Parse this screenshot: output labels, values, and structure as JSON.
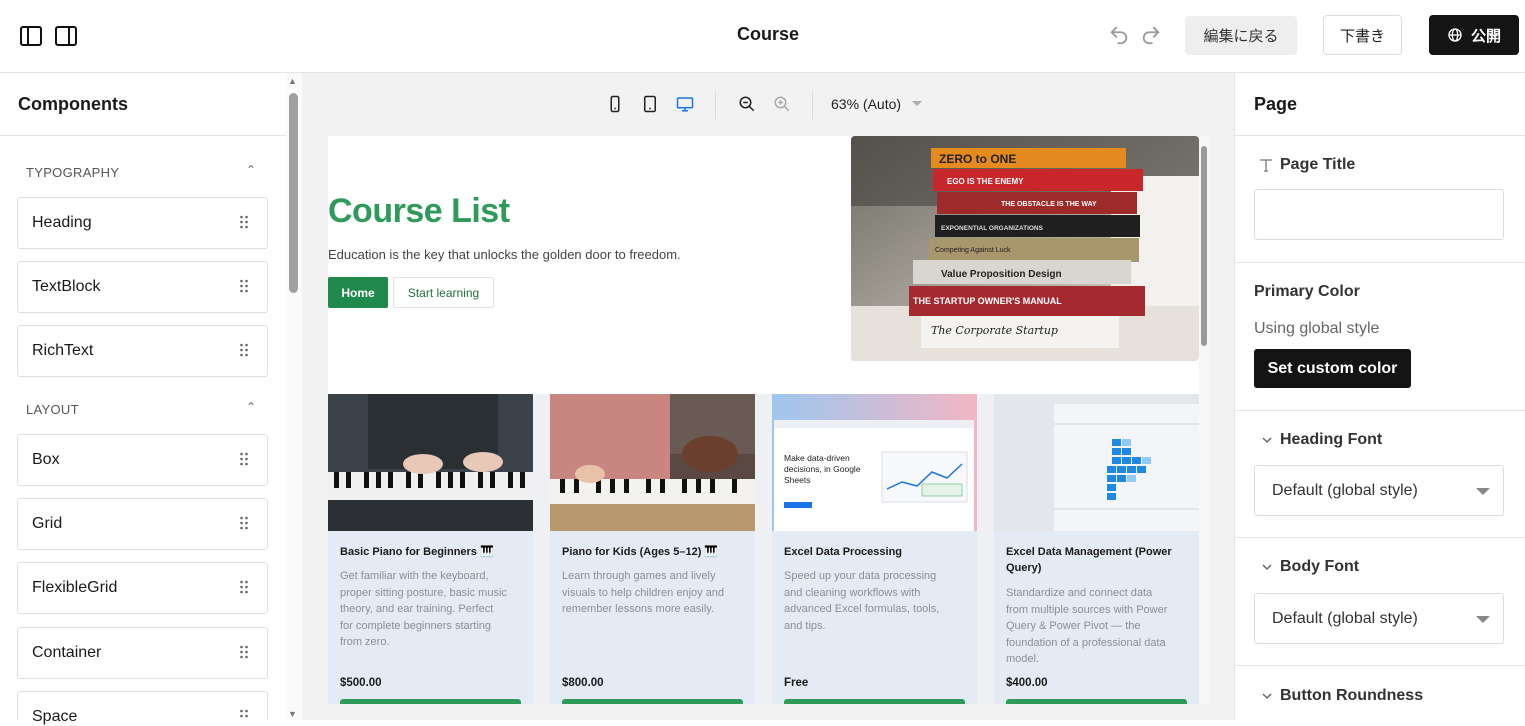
{
  "topbar": {
    "title": "Course",
    "back_label": "編集に戻る",
    "draft_label": "下書き",
    "publish_label": "公開"
  },
  "left": {
    "title": "Components",
    "sections": [
      {
        "name": "TYPOGRAPHY",
        "items": [
          "Heading",
          "TextBlock",
          "RichText"
        ]
      },
      {
        "name": "LAYOUT",
        "items": [
          "Box",
          "Grid",
          "FlexibleGrid",
          "Container",
          "Space"
        ]
      }
    ]
  },
  "canvas": {
    "zoom": "63% (Auto)",
    "hero": {
      "title": "Course List",
      "subtitle": "Education is the key that unlocks the golden door to freedom.",
      "btn_home": "Home",
      "btn_start": "Start learning",
      "book_titles": [
        "ZERO to ONE",
        "EGO IS THE ENEMY",
        "THE OBSTACLE IS THE WAY",
        "EXPONENTIAL ORGANIZATIONS",
        "Competing Against Luck",
        "Value Proposition Design",
        "THE STARTUP OWNER'S MANUAL",
        "The Corporate Startup"
      ]
    },
    "cards": [
      {
        "title": "Basic Piano for Beginners 🎹",
        "desc": "Get familiar with the keyboard, proper sitting posture, basic music theory, and ear training. Perfect for complete beginners starting from zero.",
        "desc_lines": [
          "Get familiar with the keyboard,",
          "proper sitting posture, basic music",
          "theory, and ear training. Perfect",
          "for complete beginners starting",
          "from zero."
        ],
        "price": "$500.00"
      },
      {
        "title": "Piano for Kids (Ages 5–12) 🎹",
        "desc_lines": [
          "Learn through games and lively",
          "visuals to help children enjoy and",
          "remember lessons more easily."
        ],
        "price": "$800.00"
      },
      {
        "title": "Excel Data Processing",
        "desc_lines": [
          "Speed up your data processing",
          "and cleaning workflows with",
          "advanced Excel formulas, tools,",
          "and tips."
        ],
        "price": "Free",
        "image_text": "Make data-driven decisions, in Google Sheets"
      },
      {
        "title": "Excel Data Management (Power Query)",
        "desc_lines": [
          "Standardize and connect data",
          "from multiple sources with Power",
          "Query & Power Pivot — the",
          "foundation of a professional data",
          "model."
        ],
        "price": "$400.00"
      }
    ]
  },
  "right": {
    "title": "Page",
    "page_title_label": "Page Title",
    "page_title_value": "",
    "primary_color_label": "Primary Color",
    "primary_color_hint": "Using global style",
    "set_color_label": "Set custom color",
    "heading_font_label": "Heading Font",
    "heading_font_value": "Default (global style)",
    "body_font_label": "Body Font",
    "body_font_value": "Default (global style)",
    "button_roundness_label": "Button Roundness"
  },
  "colors": {
    "brand_green": "#2e9b5b",
    "button_green": "#1f8a4c",
    "dark": "#141414"
  }
}
